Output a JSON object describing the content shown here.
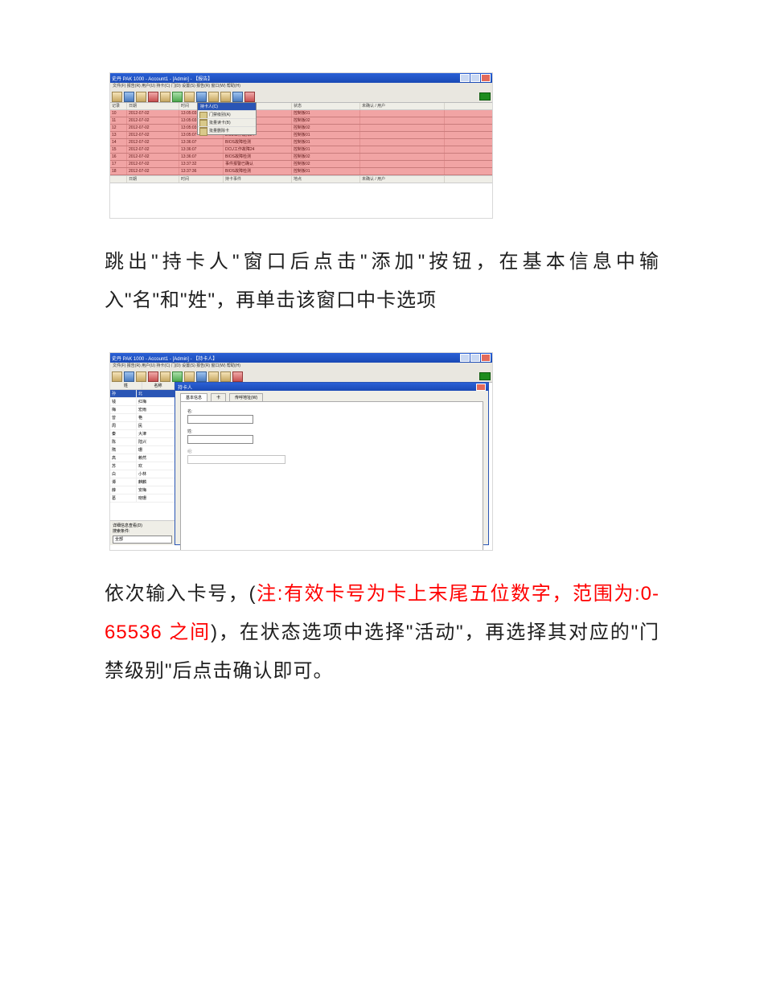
{
  "screenshot1": {
    "title": "史丹 PAK 1000 - Account1 - [Admin] - 【报告】",
    "menu": "文件(F)  报告(R)  用户(U)  持卡(C)  门(D)  设置(S)  报告(R)  窗口(W)  帮助(H)",
    "dropdown": {
      "header": "持卡人(C)",
      "items": [
        "门禁级别(A)",
        "批量读卡(B)",
        "批量删除卡"
      ]
    },
    "headers": {
      "c1": "记录",
      "c2": "日期",
      "c3": "时间",
      "c4": "持卡事件",
      "c5": "状态",
      "c6": "未确认 / 用户"
    },
    "rows": [
      {
        "n": "10",
        "date": "2012-07-02",
        "time": "13:05:03",
        "event": "BIOS故障检测",
        "status": "控制板01"
      },
      {
        "n": "11",
        "date": "2012-07-02",
        "time": "13:05:03",
        "event": "BIOS故障检测",
        "status": "控制板02"
      },
      {
        "n": "12",
        "date": "2012-07-02",
        "time": "13:05:03",
        "event": "BIOS故障检测",
        "status": "控制板02"
      },
      {
        "n": "13",
        "date": "2012-07-02",
        "time": "13:05:07",
        "event": "DCU工作故障24",
        "status": "控制板01"
      },
      {
        "n": "14",
        "date": "2012-07-02",
        "time": "13:36:07",
        "event": "BIOS故障检测",
        "status": "控制板01"
      },
      {
        "n": "15",
        "date": "2012-07-02",
        "time": "13:36:07",
        "event": "DCU工作故障24",
        "status": "控制板01"
      },
      {
        "n": "16",
        "date": "2012-07-02",
        "time": "13:36:07",
        "event": "BIOS故障检测",
        "status": "控制板02"
      },
      {
        "n": "17",
        "date": "2012-07-02",
        "time": "13:37:32",
        "event": "事件报警已确认",
        "status": "控制板02"
      },
      {
        "n": "18",
        "date": "2012-07-02",
        "time": "13:37:36",
        "event": "BIOS故障检测",
        "status": "控制板01"
      }
    ],
    "lower_headers": {
      "c1": "",
      "c2": "日期",
      "c3": "时间",
      "c4": "持卡事件",
      "c5": "地点",
      "c6": "未确认 / 用户"
    }
  },
  "paragraph1": "跳出\"持卡人\"窗口后点击\"添加\"按钮，在基本信息中输入\"名\"和\"姓\"，再单击该窗口中卡选项",
  "screenshot2": {
    "title": "史丹 PAK 1000 - Account1 - [Admin] - 【持卡人】",
    "menu": "文件(F)  报告(R)  用户(U)  持卡(C)  门(D)  设置(S)  报告(R)  窗口(W)  帮助(H)",
    "left_header": {
      "a": "姓",
      "b": "名称"
    },
    "left_rows": [
      {
        "a": "孙",
        "b": "北"
      },
      {
        "a": "钱",
        "b": "红梅"
      },
      {
        "a": "梅",
        "b": "宏雨"
      },
      {
        "a": "曾",
        "b": "艳"
      },
      {
        "a": "周",
        "b": "民"
      },
      {
        "a": "秦",
        "b": "大津"
      },
      {
        "a": "陈",
        "b": "陆兴"
      },
      {
        "a": "隋",
        "b": "珊"
      },
      {
        "a": "高",
        "b": "赖然"
      },
      {
        "a": "苏",
        "b": "欢"
      },
      {
        "a": "白",
        "b": "小林"
      },
      {
        "a": "谭",
        "b": "麒麟"
      },
      {
        "a": "薛",
        "b": "安梅"
      },
      {
        "a": "葛",
        "b": "晓珊"
      }
    ],
    "left_footer_check": "详细信息查看(D)",
    "left_footer_label": "搜索条件:",
    "left_footer_combo": "全部",
    "modal": {
      "title": "持卡人",
      "tabs": [
        "基本信息",
        "卡",
        "传呼地址(W)"
      ],
      "field_name_label": "名:",
      "field_surname_label": "姓:",
      "field_group_label": "组:"
    }
  },
  "paragraph2": {
    "p1": "依次输入卡号，(",
    "red": "注:有效卡号为卡上末尾五位数字，范围为:0-65536 之间",
    "p2": ")，在状态选项中选择\"活动\"，再选择其对应的\"门禁级别\"后点击确认即可。"
  }
}
